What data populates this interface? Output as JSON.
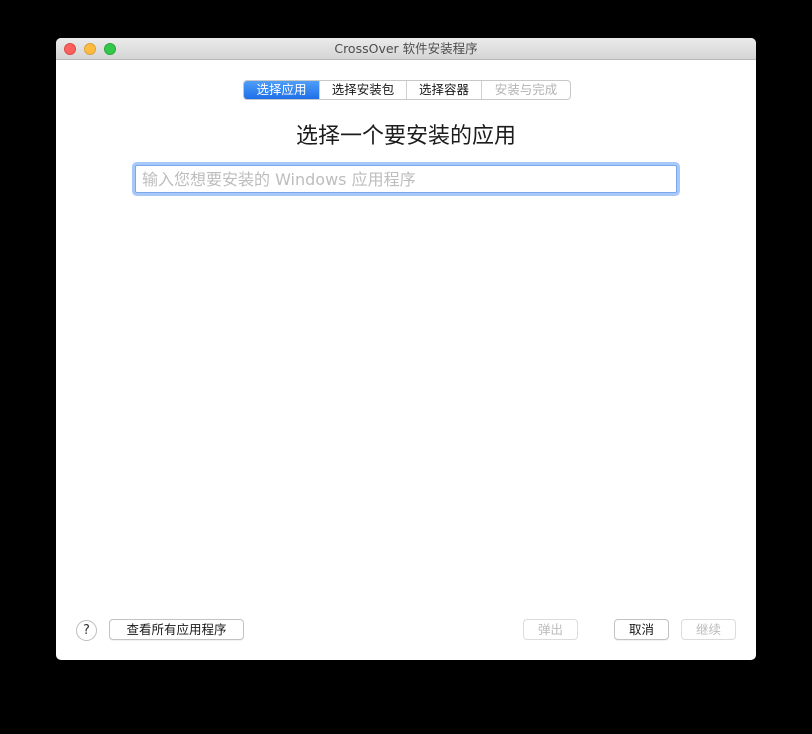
{
  "window": {
    "title": "CrossOver 软件安装程序"
  },
  "steps": [
    {
      "label": "选择应用",
      "state": "active"
    },
    {
      "label": "选择安装包",
      "state": "enabled"
    },
    {
      "label": "选择容器",
      "state": "enabled"
    },
    {
      "label": "安装与完成",
      "state": "disabled"
    }
  ],
  "main": {
    "heading": "选择一个要安装的应用",
    "search": {
      "value": "",
      "placeholder": "输入您想要安装的 Windows 应用程序"
    }
  },
  "footer": {
    "help_label": "?",
    "view_all_label": "查看所有应用程序",
    "eject_label": "弹出",
    "cancel_label": "取消",
    "continue_label": "继续"
  },
  "colors": {
    "accent": "#1e6fe8",
    "focus_ring": "#a8c8f8",
    "close": "#fc605c",
    "minimize": "#fdbc40",
    "maximize": "#34c84a"
  },
  "icons": {
    "close": "close-traffic-light-icon",
    "minimize": "minimize-traffic-light-icon",
    "maximize": "maximize-traffic-light-icon"
  }
}
